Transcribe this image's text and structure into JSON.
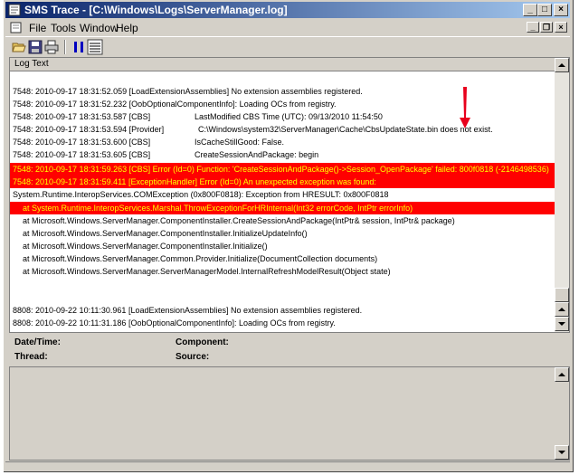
{
  "window": {
    "title": "SMS Trace - [C:\\Windows\\Logs\\ServerManager.log]",
    "minimize": "_",
    "maximize": "□",
    "close": "×"
  },
  "menu": {
    "items": [
      "File",
      "Tools",
      "Window",
      "Help"
    ],
    "mdi_min": "_",
    "mdi_restore": "❐",
    "mdi_close": "×"
  },
  "toolbar": {
    "icons": [
      "open-folder-icon",
      "save-icon",
      "print-icon",
      "pause-icon",
      "highlight-icon"
    ]
  },
  "log": {
    "header": "Log Text",
    "lines": [
      {
        "text": "7548: 2010-09-17 18:31:52.059 [LoadExtensionAssemblies]   No extension assemblies registered.",
        "type": "normal"
      },
      {
        "text": "7548: 2010-09-17 18:31:52.232 [OobOptionalComponentInfo]: Loading OCs from registry.",
        "type": "normal"
      },
      {
        "text": "7548: 2010-09-17 18:31:53.587 [CBS]",
        "col2": "LastModified CBS Time (UTC): 09/13/2010 11:54:50",
        "col2x": 204,
        "type": "normal"
      },
      {
        "text": "7548: 2010-09-17 18:31:53.594 [Provider]",
        "col2": "C:\\Windows\\system32\\ServerManager\\Cache\\CbsUpdateState.bin does not exist.",
        "col2x": 208,
        "type": "normal"
      },
      {
        "text": "7548: 2010-09-17 18:31:53.600 [CBS]",
        "col2": "IsCacheStillGood: False.",
        "col2x": 204,
        "type": "normal"
      },
      {
        "text": "7548: 2010-09-17 18:31:53.605 [CBS]",
        "col2": "CreateSessionAndPackage: begin",
        "col2x": 204,
        "type": "normal"
      },
      {
        "text": "7548: 2010-09-17 18:31:59.263 [CBS] Error (Id=0) Function: 'CreateSessionAndPackage()->Session_OpenPackage' failed: 800f0818 (-2146498536)",
        "type": "err"
      },
      {
        "text": "7548: 2010-09-17 18:31:59.411 [ExceptionHandler] Error (Id=0) An unexpected exception was found:",
        "type": "err"
      },
      {
        "text": "System.Runtime.InteropServices.COMException (0x800F0818): Exception from HRESULT: 0x800F0818",
        "type": "normal"
      },
      {
        "text": "at System.Runtime.InteropServices.Marshal.ThrowExceptionForHRInternal(Int32 errorCode, IntPtr errorInfo)",
        "type": "err-indent"
      },
      {
        "text": "at Microsoft.Windows.ServerManager.ComponentInstaller.CreateSessionAndPackage(IntPtr& session, IntPtr& package)",
        "type": "indent"
      },
      {
        "text": "at Microsoft.Windows.ServerManager.ComponentInstaller.InitializeUpdateInfo()",
        "type": "indent"
      },
      {
        "text": "at Microsoft.Windows.ServerManager.ComponentInstaller.Initialize()",
        "type": "indent"
      },
      {
        "text": "at Microsoft.Windows.ServerManager.Common.Provider.Initialize(DocumentCollection documents)",
        "type": "indent"
      },
      {
        "text": "at Microsoft.Windows.ServerManager.ServerManagerModel.InternalRefreshModelResult(Object state)",
        "type": "indent"
      },
      {
        "text": "",
        "type": "normal"
      },
      {
        "text": "",
        "type": "normal"
      },
      {
        "text": "8808: 2010-09-22 10:11:30.961 [LoadExtensionAssemblies]   No extension assemblies registered.",
        "type": "normal"
      },
      {
        "text": "8808: 2010-09-22 10:11:31.186 [OobOptionalComponentInfo]: Loading OCs from registry.",
        "type": "normal"
      }
    ]
  },
  "details": {
    "date_label": "Date/Time:",
    "component_label": "Component:",
    "thread_label": "Thread:",
    "source_label": "Source:"
  },
  "colors": {
    "error_bg": "#ff0000",
    "error_fg": "#ffff00",
    "annotation_arrow": "#e8001c",
    "titlebar": "#0a246a"
  }
}
